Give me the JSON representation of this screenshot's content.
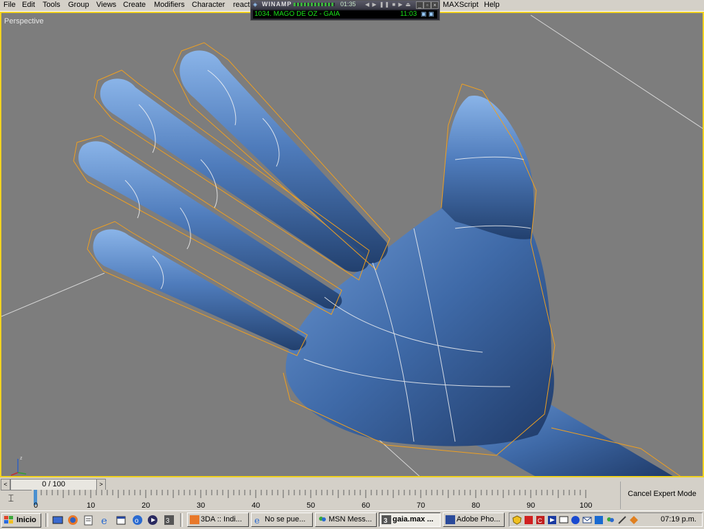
{
  "menu": {
    "items": [
      "File",
      "Edit",
      "Tools",
      "Group",
      "Views",
      "Create",
      "Modifiers",
      "Character",
      "react",
      "MAXScript",
      "Help"
    ]
  },
  "winamp": {
    "title": "WINAMP",
    "elapsed": "01:35",
    "song": "1034. MAGO DE OZ - GAIA",
    "song_time": "11:03"
  },
  "viewport": {
    "label": "Perspective",
    "background": "#7d7d7d",
    "border_color": "#f2d320",
    "model_color": "#3f6aa8",
    "cage_color": "#f0a020"
  },
  "timeline": {
    "frame_display": "0 / 100",
    "prev_label": "<",
    "next_label": ">",
    "ticks": [
      "0",
      "10",
      "20",
      "30",
      "40",
      "50",
      "60",
      "70",
      "80",
      "90",
      "100"
    ],
    "expert_mode_label": "Cancel Expert Mode"
  },
  "taskbar": {
    "start_label": "Inicio",
    "tasks": [
      {
        "label": "3DA :: Indi...",
        "active": false
      },
      {
        "label": "No se pue...",
        "active": false
      },
      {
        "label": "MSN Mess...",
        "active": false
      },
      {
        "label": "gaia.max ...",
        "active": true
      },
      {
        "label": "Adobe Pho...",
        "active": false
      }
    ],
    "clock": "07:19 p.m."
  }
}
